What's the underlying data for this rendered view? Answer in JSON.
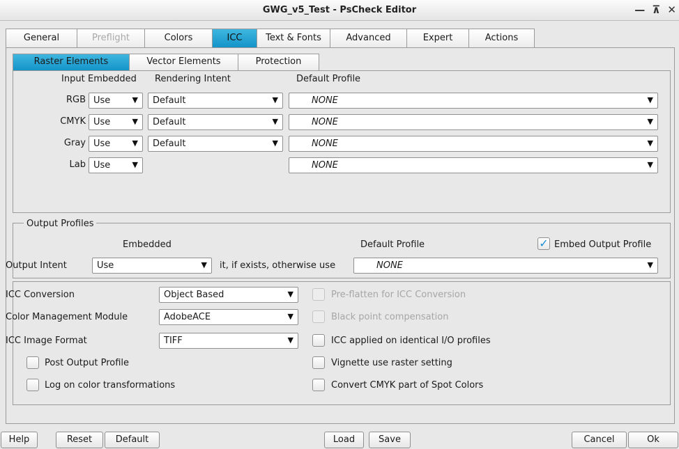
{
  "window": {
    "title": "GWG_v5_Test - PsCheck Editor",
    "controls": [
      "—",
      "⊼",
      "✕"
    ]
  },
  "main_tabs": [
    "General",
    "Preflight",
    "Colors",
    "ICC",
    "Text & Fonts",
    "Advanced",
    "Expert",
    "Actions"
  ],
  "sub_tabs": [
    "Raster Elements",
    "Vector Elements",
    "Protection"
  ],
  "raster": {
    "headers": {
      "input": "Input",
      "embedded": "Embedded",
      "rendering_intent": "Rendering Intent",
      "default_profile": "Default Profile"
    },
    "rows": [
      {
        "label": "RGB",
        "embedded": "Use",
        "intent": "Default",
        "profile": "NONE"
      },
      {
        "label": "CMYK",
        "embedded": "Use",
        "intent": "Default",
        "profile": "NONE"
      },
      {
        "label": "Gray",
        "embedded": "Use",
        "intent": "Default",
        "profile": "NONE"
      },
      {
        "label": "Lab",
        "embedded": "Use",
        "profile": "NONE"
      }
    ]
  },
  "output": {
    "legend": "Output Profiles",
    "embedded_label": "Embedded",
    "default_profile_label": "Default Profile",
    "embed_output_profile": {
      "label": "Embed Output Profile",
      "checked": true
    },
    "intent_label": "Output Intent",
    "intent_value": "Use",
    "otherwise_text": "it, if exists, otherwise use",
    "profile_value": "NONE"
  },
  "icc": {
    "conversion_label": "ICC Conversion",
    "conversion_value": "Object Based",
    "cmm_label": "Color Management Module",
    "cmm_value": "AdobeACE",
    "image_format_label": "ICC Image Format",
    "image_format_value": "TIFF",
    "post_output_profile": "Post Output Profile",
    "log_on_color": "Log on color transformations",
    "pre_flatten": "Pre-flatten for ICC Conversion",
    "black_point": "Black point compensation",
    "icc_identical": "ICC applied on identical I/O profiles",
    "vignette": "Vignette use raster setting",
    "convert_cmyk": "Convert CMYK part of Spot Colors"
  },
  "buttons": {
    "help": "Help",
    "reset": "Reset",
    "default": "Default",
    "load": "Load",
    "save": "Save",
    "cancel": "Cancel",
    "ok": "Ok"
  },
  "accent_color": "#1394c8"
}
